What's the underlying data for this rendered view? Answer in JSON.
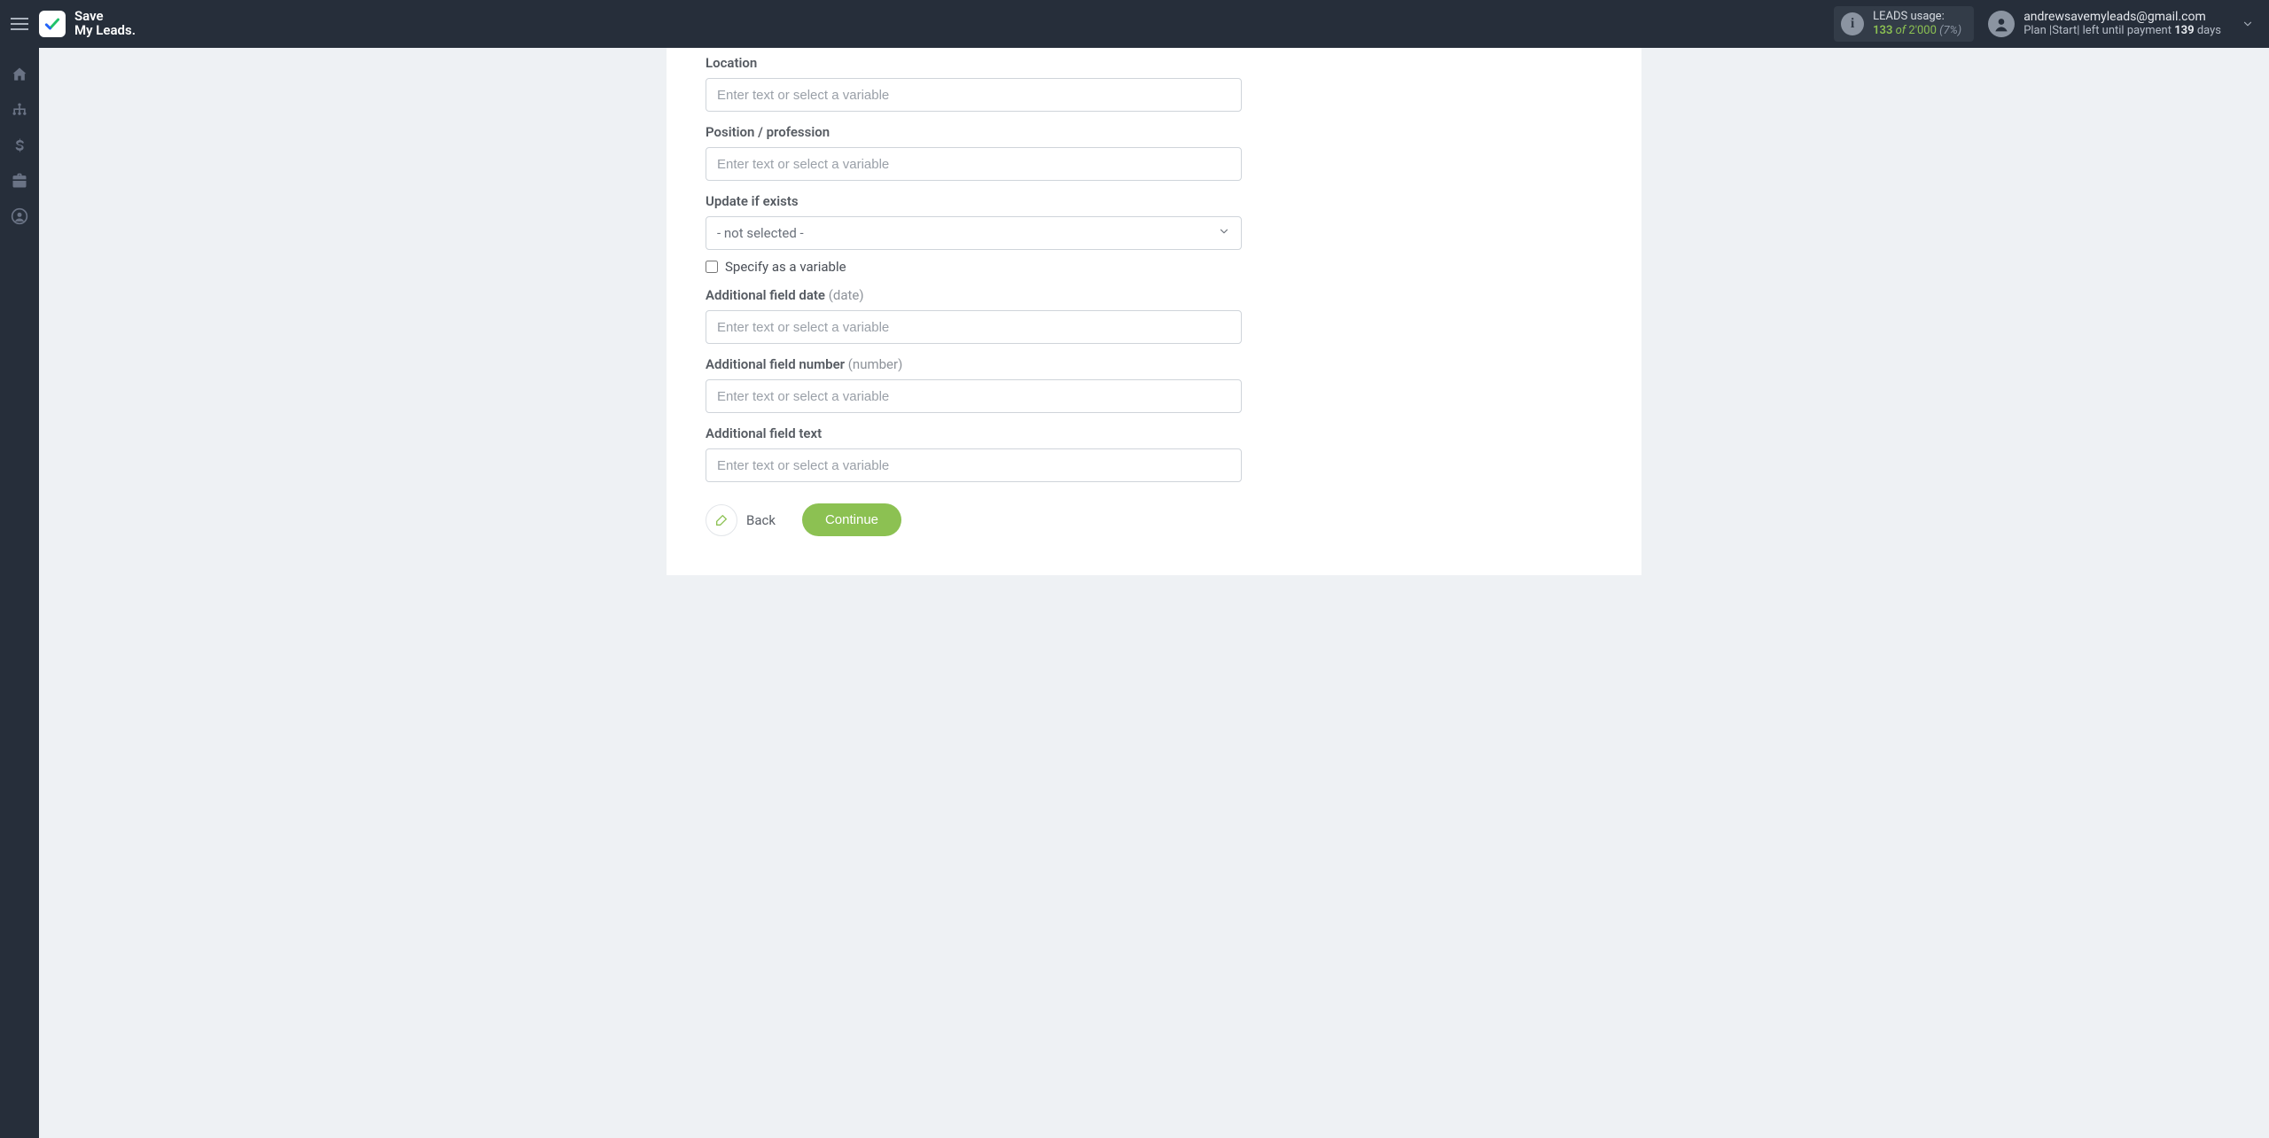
{
  "brand": {
    "line1": "Save",
    "line2": "My Leads."
  },
  "header": {
    "usage_label": "LEADS usage:",
    "usage_count": "133",
    "usage_of": "of",
    "usage_total": "2'000",
    "usage_pct": "(7%)",
    "email": "andrewsavemyleads@gmail.com",
    "plan_prefix": "Plan |Start| left until payment ",
    "plan_days_num": "139",
    "plan_days_suffix": " days"
  },
  "form": {
    "location_label": "Location",
    "location_ph": "Enter text or select a variable",
    "position_label": "Position / profession",
    "position_ph": "Enter text or select a variable",
    "update_label": "Update if exists",
    "update_value": "- not selected -",
    "specify_label": "Specify as a variable",
    "afd_label": "Additional field date ",
    "afd_hint": "(date)",
    "afd_ph": "Enter text or select a variable",
    "afn_label": "Additional field number ",
    "afn_hint": "(number)",
    "afn_ph": "Enter text or select a variable",
    "aft_label": "Additional field text",
    "aft_ph": "Enter text or select a variable"
  },
  "buttons": {
    "back": "Back",
    "continue": "Continue"
  }
}
